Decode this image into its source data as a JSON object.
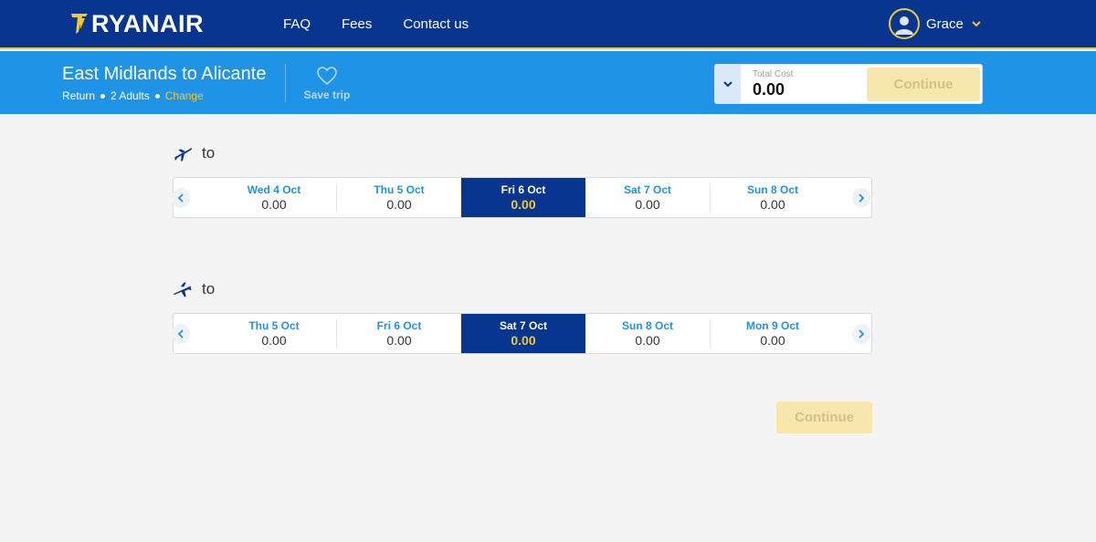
{
  "brand": {
    "name": "RYANAIR",
    "color_primary": "#073590",
    "color_accent": "#f1c933",
    "color_secondary": "#1f93e5"
  },
  "nav": {
    "items": [
      {
        "label": "FAQ"
      },
      {
        "label": "Fees"
      },
      {
        "label": "Contact us"
      }
    ]
  },
  "user": {
    "name": "Grace",
    "icon": "user-avatar-icon"
  },
  "trip": {
    "route": "East Midlands to Alicante",
    "type": "Return",
    "passengers": "2 Adults",
    "change_label": "Change",
    "save_label": "Save trip"
  },
  "cost": {
    "label": "Total Cost",
    "value": "0.00",
    "continue_label": "Continue"
  },
  "outbound": {
    "to_label": "to",
    "dates": [
      {
        "label": "Wed 4 Oct",
        "price": "0.00",
        "selected": false
      },
      {
        "label": "Thu 5 Oct",
        "price": "0.00",
        "selected": false
      },
      {
        "label": "Fri 6 Oct",
        "price": "0.00",
        "selected": true
      },
      {
        "label": "Sat 7 Oct",
        "price": "0.00",
        "selected": false
      },
      {
        "label": "Sun 8 Oct",
        "price": "0.00",
        "selected": false
      }
    ]
  },
  "inbound": {
    "to_label": "to",
    "dates": [
      {
        "label": "Thu 5 Oct",
        "price": "0.00",
        "selected": false
      },
      {
        "label": "Fri 6 Oct",
        "price": "0.00",
        "selected": false
      },
      {
        "label": "Sat 7 Oct",
        "price": "0.00",
        "selected": true
      },
      {
        "label": "Sun 8 Oct",
        "price": "0.00",
        "selected": false
      },
      {
        "label": "Mon 9 Oct",
        "price": "0.00",
        "selected": false
      }
    ]
  },
  "footer": {
    "continue_label": "Continue"
  }
}
